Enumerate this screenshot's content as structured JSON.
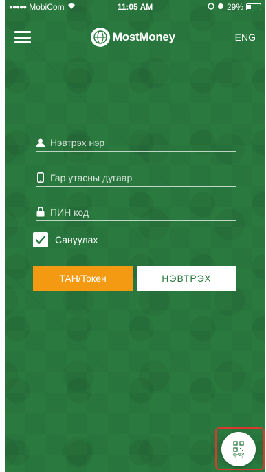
{
  "status_bar": {
    "carrier": "MobiCom",
    "time": "11:05 AM",
    "battery": "29%"
  },
  "header": {
    "app_name": "MostMoney",
    "language": "ENG"
  },
  "form": {
    "username_placeholder": "Нэвтрэх нэр",
    "phone_placeholder": "Гар утасны дугаар",
    "pin_placeholder": "ПИН код",
    "remember_label": "Сануулах",
    "remember_checked": true
  },
  "buttons": {
    "tan_token": "ТАН/Токен",
    "login": "НЭВТРЭХ"
  },
  "qpay": {
    "label": "qPay"
  },
  "colors": {
    "background": "#2a7a3f",
    "accent_orange": "#f39a12",
    "highlight_red": "#d83b2e"
  }
}
